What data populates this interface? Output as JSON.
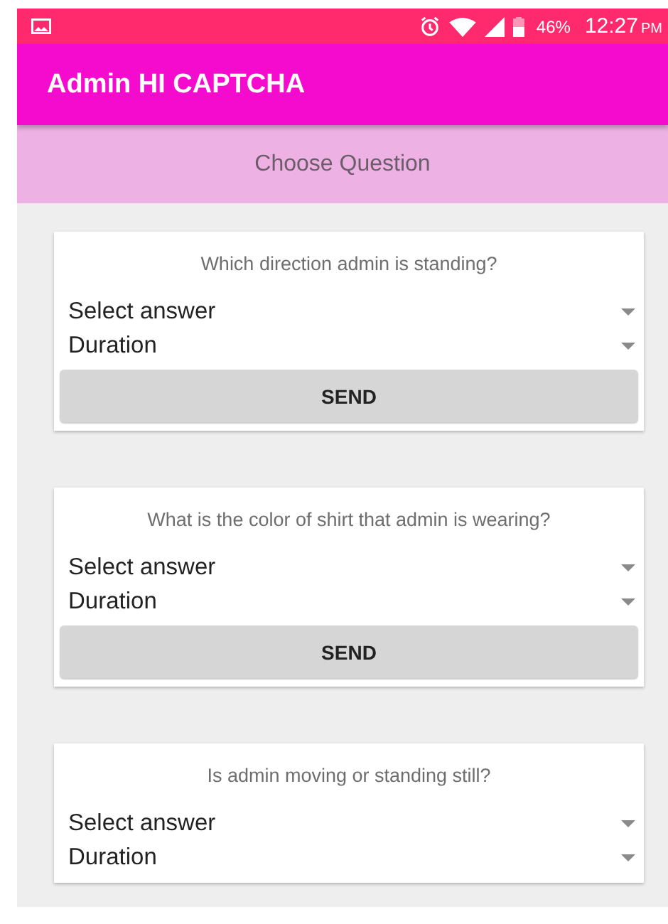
{
  "status_bar": {
    "battery": "46%",
    "time": "12:27",
    "ampm": "PM"
  },
  "app_bar": {
    "title": "Admin HI CAPTCHA"
  },
  "header": {
    "label": "Choose Question"
  },
  "questions": [
    {
      "question": "Which direction admin is standing?",
      "answer_placeholder": "Select answer",
      "duration_placeholder": "Duration",
      "button": "SEND"
    },
    {
      "question": "What is the color of shirt that admin is wearing?",
      "answer_placeholder": "Select answer",
      "duration_placeholder": "Duration",
      "button": "SEND"
    },
    {
      "question": "Is admin moving or standing still?",
      "answer_placeholder": "Select answer",
      "duration_placeholder": "Duration"
    }
  ]
}
